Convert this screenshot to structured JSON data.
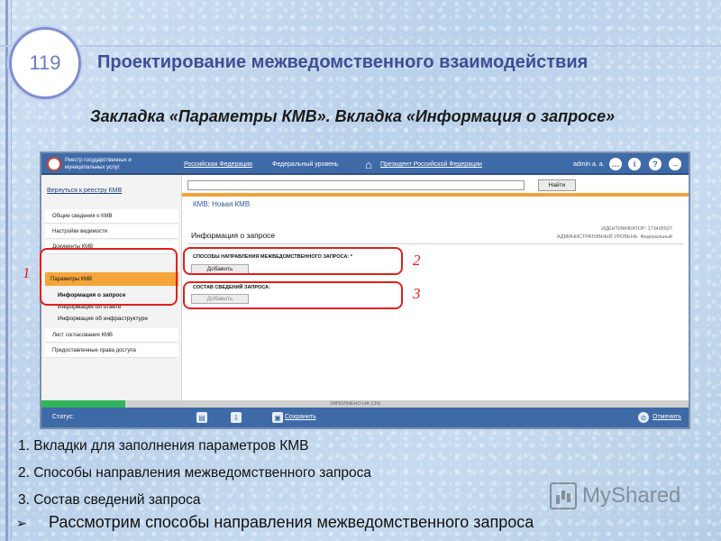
{
  "slide": {
    "number": "119",
    "title": "Проектирование межведомственного взаимодействия",
    "subtitle": "Закладка «Параметры КМВ». Вкладка «Информация о запросе»"
  },
  "app": {
    "topbar": {
      "registry_label": "Реестр государственных и муниципальных услуг",
      "nav_federation": "Российская Федерация",
      "nav_level": "Федеральный уровень",
      "nav_president": "Президент Российской Федерации",
      "user": "admin a. a."
    },
    "sidebar": {
      "back_link": "Вернуться к реестру КМВ",
      "items": [
        "Общие сведения о КМВ",
        "Настройки видимости",
        "Документы КМВ"
      ],
      "active_section": "Параметры КМВ",
      "subitems": [
        "Информация о запросе",
        "Информация об ответе",
        "Информация об инфраструктуре"
      ],
      "bottom_items": [
        "Лист согласования КМВ",
        "Предоставленные права доступа"
      ]
    },
    "search": {
      "value": "",
      "button": "Найти"
    },
    "main": {
      "title": "КМВ: Новая КМВ",
      "identifier": "ИДЕНТИФИКАТОР: 173495507",
      "admin_level": "АДМИНИСТРАТИВНЫЙ УРОВЕНЬ: Федеральный",
      "panel_title": "Информация о запросе",
      "block1_label": "СПОСОБЫ НАПРАВЛЕНИЯ МЕЖВЕДОМСТВЕННОГО ЗАПРОСА: *",
      "block1_button": "Добавить",
      "block2_label": "СОСТАВ СВЕДЕНИЙ ЗАПРОСА:",
      "block2_button": "Добавить"
    },
    "progress": {
      "label": "ЗАПОЛНЕНО НА 13%",
      "fraction": 0.13
    },
    "statusbar": {
      "status_label": "Статус:",
      "save": "Сохранить",
      "cancel": "Отменить"
    }
  },
  "callouts": [
    "1",
    "2",
    "3"
  ],
  "notes": [
    "1. Вкладки для заполнения параметров КМВ",
    "2. Способы направления межведомственного запроса",
    "3. Состав сведений запроса"
  ],
  "final_note": "Рассмотрим способы направления межведомственного запроса",
  "watermark": "MyShared",
  "colors": {
    "title": "#3e4e94",
    "app_bar": "#3f6aa8",
    "active_tab": "#f5a53a",
    "callout": "#e0201c",
    "progress": "#33b35a"
  }
}
